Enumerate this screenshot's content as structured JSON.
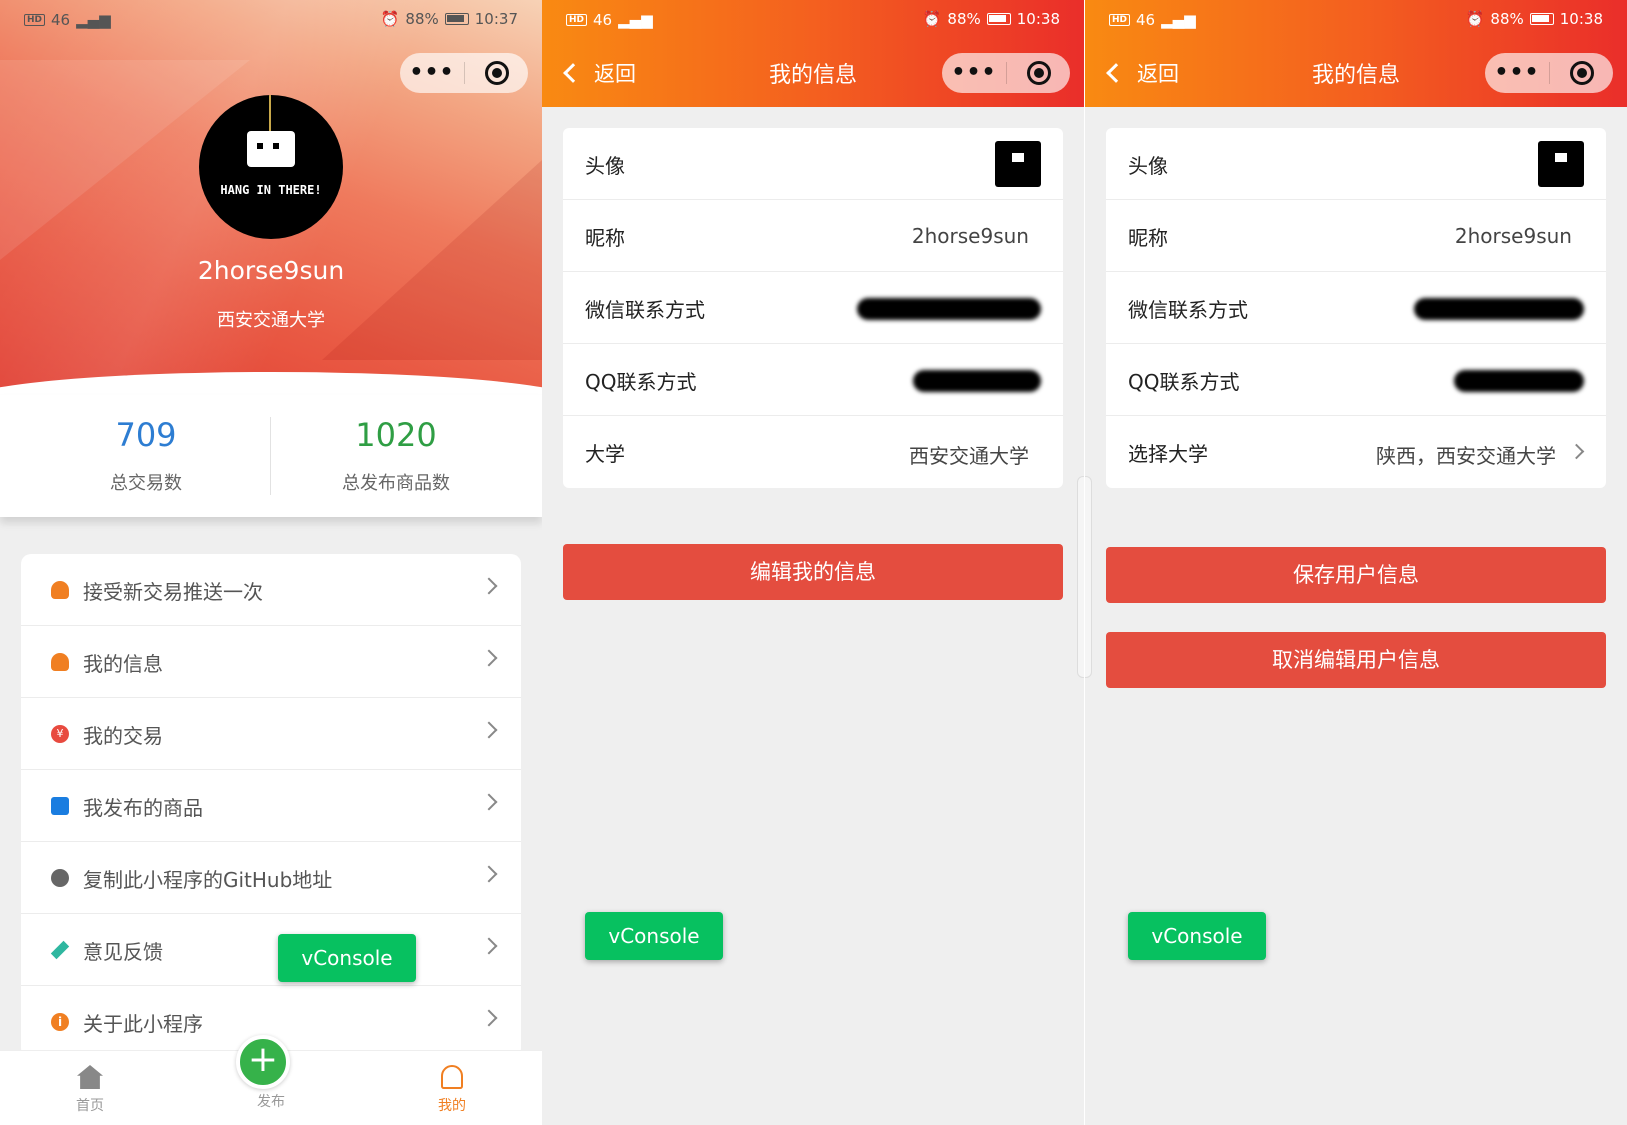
{
  "screen1": {
    "status": {
      "signal": "46",
      "battery": "88%",
      "time": "10:37"
    },
    "profile": {
      "username": "2horse9sun",
      "school": "西安交通大学",
      "avatar_text": "HANG IN THERE!"
    },
    "stats": [
      {
        "value": "709",
        "label": "总交易数"
      },
      {
        "value": "1020",
        "label": "总发布商品数"
      }
    ],
    "menu": [
      {
        "label": "接受新交易推送一次",
        "icon": "person-icon"
      },
      {
        "label": "我的信息",
        "icon": "person-icon"
      },
      {
        "label": "我的交易",
        "icon": "yuan-icon"
      },
      {
        "label": "我发布的商品",
        "icon": "list-icon"
      },
      {
        "label": "复制此小程序的GitHub地址",
        "icon": "github-icon"
      },
      {
        "label": "意见反馈",
        "icon": "pen-icon"
      },
      {
        "label": "关于此小程序",
        "icon": "info-icon"
      }
    ],
    "yuan_glyph": "¥",
    "info_glyph": "i",
    "tabs": {
      "home": "首页",
      "publish": "发布",
      "me": "我的"
    },
    "vconsole": "vConsole"
  },
  "screen2": {
    "status": {
      "signal": "46",
      "battery": "88%",
      "time": "10:38"
    },
    "back": "返回",
    "title": "我的信息",
    "rows": {
      "avatar": "头像",
      "nickname": "昵称",
      "nickname_value": "2horse9sun",
      "wechat": "微信联系方式",
      "qq": "QQ联系方式",
      "university": "大学",
      "university_value": "西安交通大学"
    },
    "edit_button": "编辑我的信息",
    "vconsole": "vConsole"
  },
  "screen3": {
    "status": {
      "signal": "46",
      "battery": "88%",
      "time": "10:38"
    },
    "back": "返回",
    "title": "我的信息",
    "rows": {
      "avatar": "头像",
      "nickname": "昵称",
      "nickname_value": "2horse9sun",
      "wechat": "微信联系方式",
      "qq": "QQ联系方式",
      "university": "选择大学",
      "university_value": "陕西，西安交通大学"
    },
    "save_button": "保存用户信息",
    "cancel_button": "取消编辑用户信息",
    "vconsole": "vConsole"
  },
  "colors": {
    "accent_orange": "#f98a12",
    "accent_red": "#ea2e2a",
    "button_red": "#e44d3f",
    "vconsole_green": "#07c160",
    "stat_blue": "#2d7dd2",
    "stat_green": "#2f9e44"
  }
}
